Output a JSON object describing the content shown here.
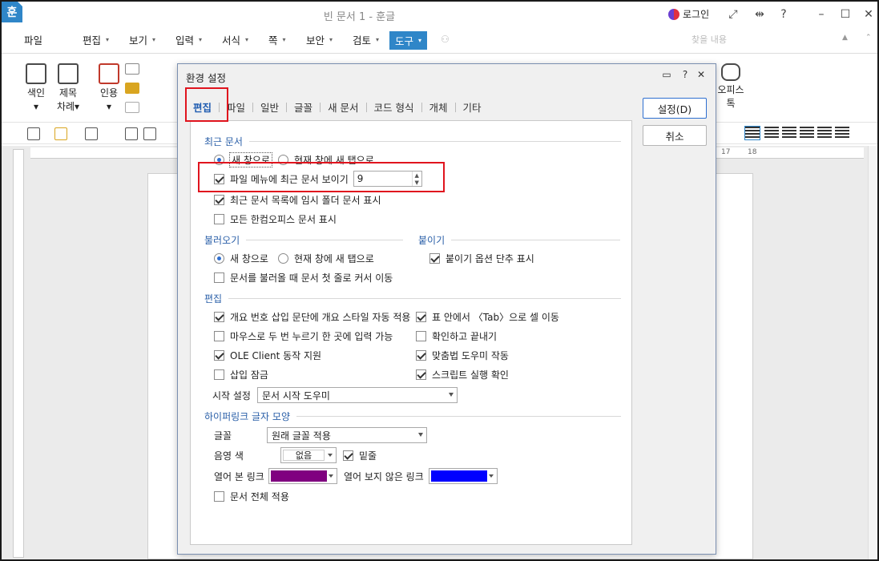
{
  "window": {
    "app_icon_glyph": "훈",
    "title": "빈 문서 1 - 훈글",
    "login_label": "로그인"
  },
  "menubar": {
    "items": [
      {
        "label": "파일",
        "dd": ""
      },
      {
        "label": "편집",
        "dd": "▾"
      },
      {
        "label": "보기",
        "dd": "▾"
      },
      {
        "label": "입력",
        "dd": "▾"
      },
      {
        "label": "서식",
        "dd": "▾"
      },
      {
        "label": "쪽",
        "dd": "▾"
      },
      {
        "label": "보안",
        "dd": "▾"
      },
      {
        "label": "검토",
        "dd": "▾"
      },
      {
        "label": "도구",
        "dd": "▾"
      }
    ],
    "find_placeholder": "찾을 내용"
  },
  "ribbon": {
    "buttons": [
      {
        "label": "색인",
        "sub": "▾"
      },
      {
        "label": "제목",
        "sub": "차례▾"
      },
      {
        "label": "인용",
        "sub": "▾"
      },
      {
        "label": "오피스",
        "sub": "톡"
      }
    ]
  },
  "ruler": {
    "marks": [
      "17",
      "18"
    ]
  },
  "dialog": {
    "title": "환경 설정",
    "tabs": [
      "편집",
      "파일",
      "일반",
      "글꼴",
      "새 문서",
      "코드 형식",
      "개체",
      "기타"
    ],
    "active_tab": "편집",
    "ok_label": "설정(D)",
    "cancel_label": "취소",
    "sections": {
      "recent": "최근 문서",
      "open": "불러오기",
      "paste": "붙이기",
      "edit": "편집",
      "hyperlink": "하이퍼링크 글자 모양"
    },
    "recent": {
      "radio_new_window": "새 창으로",
      "radio_new_tab": "현재 창에 새 탭으로",
      "show_recent_in_menu": "파일 메뉴에 최근 문서 보이기",
      "recent_count": "9",
      "show_temp_folder": "최근 문서 목록에 임시 폴더 문서 표시",
      "show_all_office": "모든 한컴오피스 문서 표시"
    },
    "open": {
      "radio_new_window": "새 창으로",
      "radio_new_tab": "현재 창에 새 탭으로",
      "cursor_first_line": "문서를 불러올 때 문서 첫 줄로 커서 이동"
    },
    "paste": {
      "show_option_shortcut": "붙이기 옵션 단추 표시"
    },
    "edit": {
      "outline_style": "개요 번호 삽입 문단에 개요 스타일 자동 적용",
      "tab_move_cell": "표 안에서 〈Tab〉으로 셀 이동",
      "double_click_input": "마우스로 두 번 누르기 한 곳에 입력 가능",
      "confirm_exit": "확인하고 끝내기",
      "ole_client": "OLE Client 동작 지원",
      "spell_helper": "맞춤법 도우미 작동",
      "insert_lock": "삽입 잠금",
      "script_confirm": "스크립트 실행 확인",
      "start_label": "시작 설정",
      "start_value": "문서 시작 도우미"
    },
    "hyperlink": {
      "font_label": "글꼴",
      "font_value": "원래 글꼴 적용",
      "shade_label": "음영 색",
      "shade_value": "없음",
      "underline_label": "밑줄",
      "visited_label": "열어 본 링크",
      "visited_color": "#800080",
      "unvisited_label": "열어 보지 않은 링크",
      "unvisited_color": "#0000ff",
      "apply_whole_doc": "문서 전체 적용"
    }
  },
  "colors": {
    "accent": "#2f86c8",
    "highlight": "#e0141e",
    "section_title": "#2a5fa8"
  }
}
